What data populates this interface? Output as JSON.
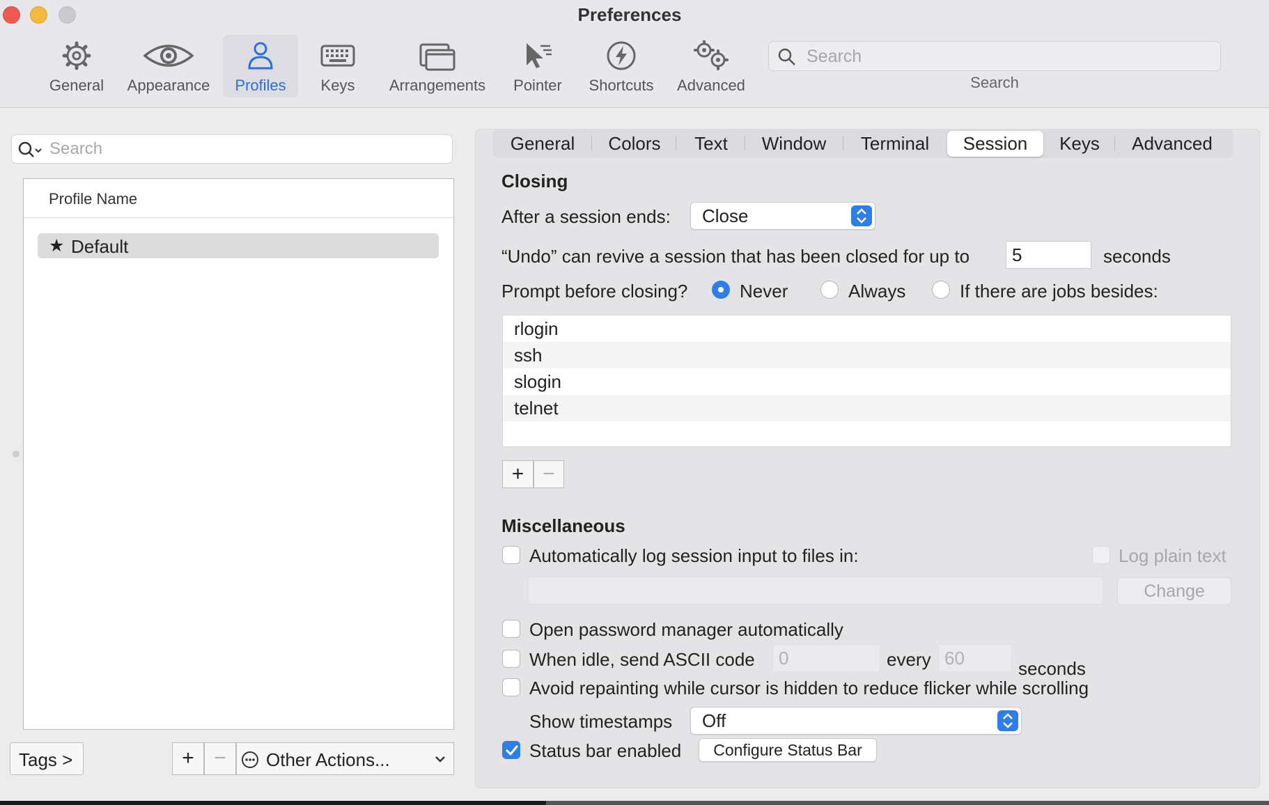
{
  "window": {
    "title": "Preferences"
  },
  "toolbar": {
    "items": [
      {
        "label": "General",
        "icon": "gear-icon"
      },
      {
        "label": "Appearance",
        "icon": "eye-icon"
      },
      {
        "label": "Profiles",
        "icon": "person-icon",
        "active": true
      },
      {
        "label": "Keys",
        "icon": "keyboard-icon"
      },
      {
        "label": "Arrangements",
        "icon": "windows-icon"
      },
      {
        "label": "Pointer",
        "icon": "pointer-icon"
      },
      {
        "label": "Shortcuts",
        "icon": "lightning-icon"
      },
      {
        "label": "Advanced",
        "icon": "gears-icon"
      }
    ],
    "search_placeholder": "Search",
    "search_caption": "Search"
  },
  "profiles": {
    "search_placeholder": "Search",
    "column_header": "Profile Name",
    "rows": [
      {
        "name": "Default",
        "is_default": true
      }
    ],
    "tags_button": "Tags >",
    "add_button": "+",
    "remove_button": "−",
    "other_actions": "Other Actions..."
  },
  "tabs": [
    "General",
    "Colors",
    "Text",
    "Window",
    "Terminal",
    "Session",
    "Keys",
    "Advanced"
  ],
  "active_tab": "Session",
  "closing": {
    "heading": "Closing",
    "after_label": "After a session ends:",
    "after_value": "Close",
    "undo_label": "“Undo” can revive a session that has been closed for up to",
    "undo_value": "5",
    "undo_unit": "seconds",
    "prompt_label": "Prompt before closing?",
    "prompt_options": [
      "Never",
      "Always",
      "If there are jobs besides:"
    ],
    "prompt_selected": "Never",
    "jobs": [
      "rlogin",
      "ssh",
      "slogin",
      "telnet"
    ],
    "add_job": "+",
    "remove_job": "−"
  },
  "misc": {
    "heading": "Miscellaneous",
    "log_label": "Automatically log session input to files in:",
    "log_checked": false,
    "log_plain_label": "Log plain text",
    "log_path": "",
    "change_button": "Change",
    "password_label": "Open password manager automatically",
    "idle_label": "When idle, send ASCII code",
    "idle_code": "0",
    "idle_every": "every",
    "idle_interval": "60",
    "idle_unit": "seconds",
    "avoid_label": "Avoid repainting while cursor is hidden to reduce flicker while scrolling",
    "timestamps_label": "Show timestamps",
    "timestamps_value": "Off",
    "statusbar_label": "Status bar enabled",
    "statusbar_checked": true,
    "configure_button": "Configure Status Bar"
  },
  "colors": {
    "accent": "#2f7ee8",
    "close": "#ee5a52",
    "minimize": "#f5b93f",
    "zoom": "#cbcbcf"
  }
}
